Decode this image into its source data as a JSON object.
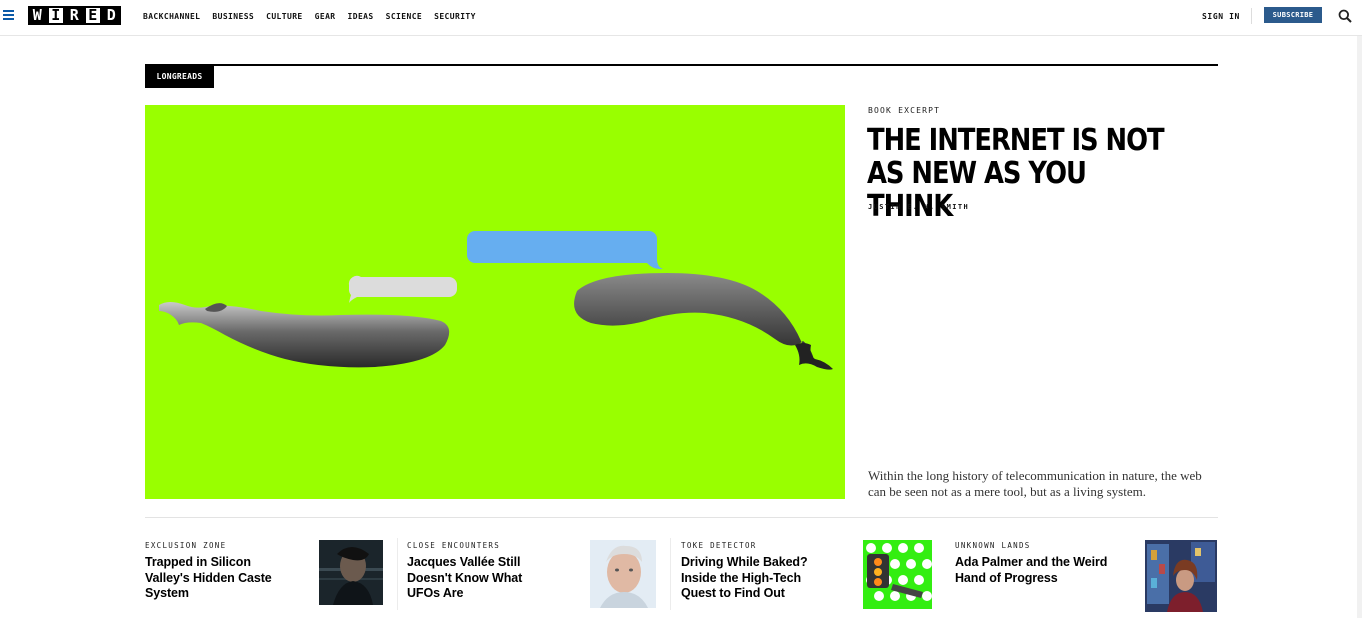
{
  "header": {
    "logo_letters": [
      "W",
      "I",
      "R",
      "E",
      "D"
    ],
    "nav": [
      "BACKCHANNEL",
      "BUSINESS",
      "CULTURE",
      "GEAR",
      "IDEAS",
      "SCIENCE",
      "SECURITY"
    ],
    "sign_in": "SIGN IN",
    "subscribe": "SUBSCRIBE"
  },
  "section": {
    "tag": "LONGREADS"
  },
  "feature": {
    "kicker": "BOOK EXCERPT",
    "headline": "The Internet Is Not As New As You Think",
    "byline": "JUSTIN E. H. SMITH",
    "dek": "Within the long history of telecommunication in nature, the web can be seen not as a mere tool, but as a living system."
  },
  "stories": [
    {
      "kicker": "EXCLUSION ZONE",
      "title": "Trapped in Silicon Valley's Hidden Caste System"
    },
    {
      "kicker": "CLOSE ENCOUNTERS",
      "title": "Jacques Vallée Still Doesn't Know What UFOs Are"
    },
    {
      "kicker": "TOKE DETECTOR",
      "title": "Driving While Baked? Inside the High-Tech Quest to Find Out"
    },
    {
      "kicker": "UNKNOWN LANDS",
      "title": "Ada Palmer and the Weird Hand of Progress"
    }
  ],
  "colors": {
    "hero_background": "#99ff00",
    "subscribe_button": "#2b5a8c",
    "menu_icon": "#0b5aa8"
  },
  "icons": [
    "hamburger-menu-icon",
    "search-icon"
  ]
}
